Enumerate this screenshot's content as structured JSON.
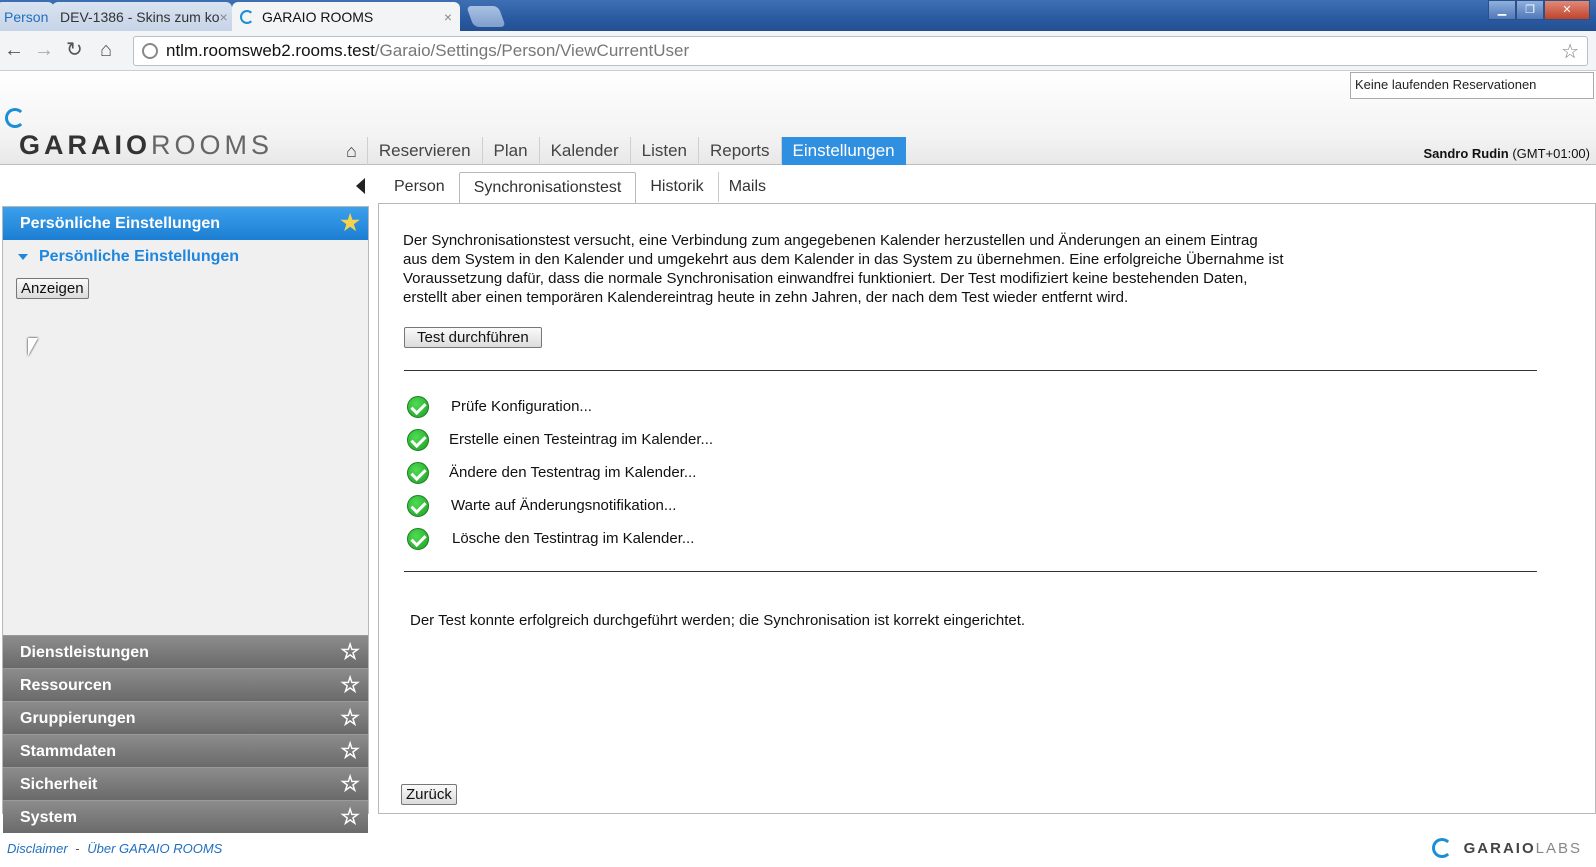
{
  "browser": {
    "tabs": [
      {
        "label": "Person"
      },
      {
        "label": "DEV-1386 - Skins zum ko"
      },
      {
        "label": "GARAIO ROOMS"
      }
    ],
    "url_host": "ntlm.roomsweb2.rooms.test",
    "url_path": "/Garaio/Settings/Person/ViewCurrentUser"
  },
  "app": {
    "logo_bold": "GARAIO",
    "logo_light": "ROOMS",
    "reservation_status": "Keine laufenden Reservationen",
    "user_name": "Sandro Rudin",
    "user_tz": "(GMT+01:00)",
    "nav": [
      {
        "label": "Reservieren"
      },
      {
        "label": "Plan"
      },
      {
        "label": "Kalender"
      },
      {
        "label": "Listen"
      },
      {
        "label": "Reports"
      },
      {
        "label": "Einstellungen",
        "active": true
      }
    ]
  },
  "sidebar": {
    "active_section": "Persönliche Einstellungen",
    "subnav": "Persönliche Einstellungen",
    "show_button": "Anzeigen",
    "sections": [
      {
        "label": "Dienstleistungen"
      },
      {
        "label": "Ressourcen"
      },
      {
        "label": "Gruppierungen"
      },
      {
        "label": "Stammdaten"
      },
      {
        "label": "Sicherheit"
      },
      {
        "label": "System"
      }
    ]
  },
  "subtabs": [
    {
      "label": "Person"
    },
    {
      "label": "Synchronisationstest",
      "active": true
    },
    {
      "label": "Historik"
    },
    {
      "label": "Mails"
    }
  ],
  "main": {
    "intro_lines": [
      "Der Synchronisationstest versucht, eine Verbindung zum angegebenen Kalender herzustellen und Änderungen an einem Eintrag",
      "aus dem System in den Kalender und umgekehrt aus dem Kalender in das System zu übernehmen. Eine erfolgreiche Übernahme ist",
      "Voraussetzung dafür, dass die normale Synchronisation einwandfrei funktioniert. Der Test modifiziert keine bestehenden Daten,",
      "erstellt aber einen temporären Kalendereintrag heute in zehn Jahren, der nach  dem Test wieder entfernt wird."
    ],
    "run_button": "Test durchführen",
    "steps": [
      {
        "label": "Prüfe Konfiguration...",
        "status": "ok"
      },
      {
        "label": "Erstelle einen Testeintrag im Kalender...",
        "status": "ok"
      },
      {
        "label": "Ändere den Testentrag im Kalender...",
        "status": "ok"
      },
      {
        "label": "Warte auf Änderungsnotifikation...",
        "status": "ok"
      },
      {
        "label": "Lösche den Testintrag im Kalender...",
        "status": "ok"
      }
    ],
    "result": "Der Test konnte erfolgreich durchgeführt werden; die Synchronisation ist korrekt eingerichtet.",
    "back_button": "Zurück"
  },
  "footer": {
    "disclaimer": "Disclaimer",
    "separator": "-",
    "about": "Über GARAIO ROOMS",
    "brand_bold": "GARAIO",
    "brand_light": "LABS"
  },
  "colors": {
    "accent": "#2f8fe0",
    "sidebar_collapsed": "#7a7a7a",
    "success": "#28a82e"
  }
}
